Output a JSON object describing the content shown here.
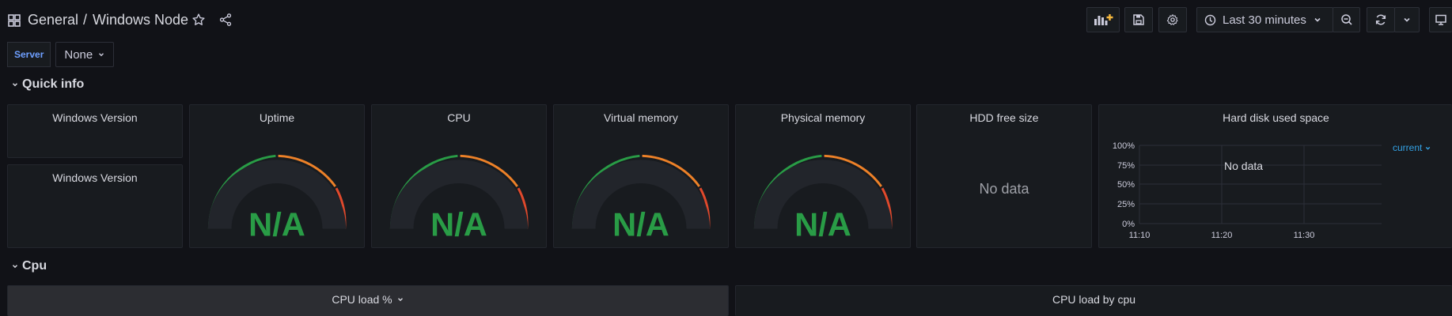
{
  "header": {
    "folder": "General",
    "separator": "/",
    "title": "Windows Node",
    "time_range": "Last 30 minutes"
  },
  "variables": [
    {
      "label": "Server",
      "value": "None"
    }
  ],
  "rows": {
    "quick_info": "Quick info",
    "cpu": "Cpu"
  },
  "panels": {
    "windows_version_1": "Windows Version",
    "windows_version_2": "Windows Version",
    "uptime": {
      "title": "Uptime",
      "value": "N/A"
    },
    "cpu": {
      "title": "CPU",
      "value": "N/A"
    },
    "virtual_memory": {
      "title": "Virtual memory",
      "value": "N/A"
    },
    "physical_memory": {
      "title": "Physical memory",
      "value": "N/A"
    },
    "hdd_free": {
      "title": "HDD free size",
      "value": "No data"
    },
    "hard_disk_used": {
      "title": "Hard disk used space",
      "no_data": "No data",
      "legend": "current",
      "y_ticks": [
        "100%",
        "75%",
        "50%",
        "25%",
        "0%"
      ],
      "x_ticks": [
        "11:10",
        "11:20",
        "11:30"
      ]
    },
    "cpu_load_pct": "CPU load %",
    "cpu_load_by_cpu": "CPU load by cpu"
  },
  "colors": {
    "gauge_green": "#299c46",
    "gauge_orange": "#ed8128",
    "gauge_red": "#e0492c",
    "value_green": "#299c46",
    "link_blue": "#33a2e5"
  }
}
